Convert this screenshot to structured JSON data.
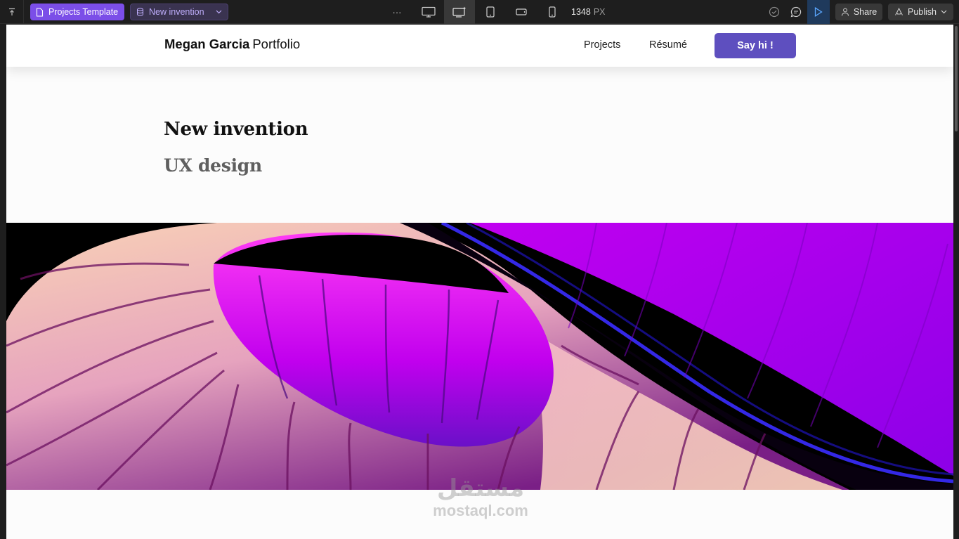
{
  "toolbar": {
    "template_label": "Projects Template",
    "page_label": "New invention",
    "more_label": "···",
    "width_value": "1348",
    "width_unit": "PX",
    "share_label": "Share",
    "publish_label": "Publish",
    "accent": "#7b4ee8"
  },
  "site": {
    "brand_bold": "Megan Garcia",
    "brand_light": "Portfolio",
    "nav": {
      "projects": "Projects",
      "resume": "Résumé",
      "cta": "Say hi !"
    },
    "cta_color": "#5e4fbf"
  },
  "project": {
    "title": "New invention",
    "subtitle": "UX design"
  },
  "watermark": {
    "arabic": "مستقل",
    "latin": "mostaql.com"
  }
}
